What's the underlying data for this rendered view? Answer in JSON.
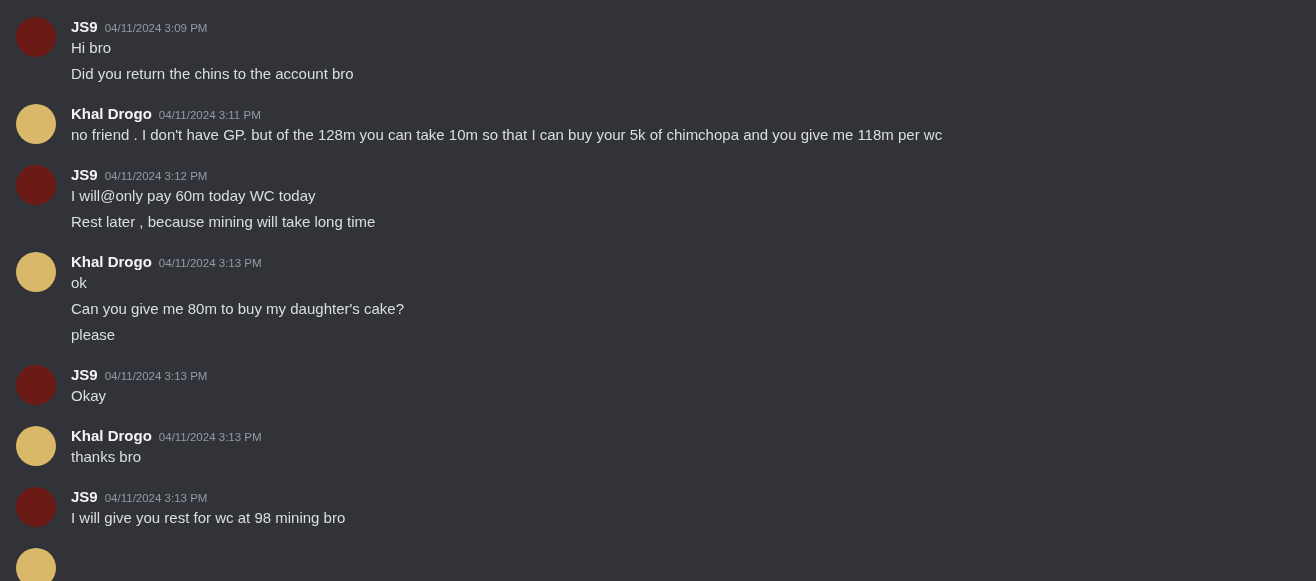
{
  "messages": [
    {
      "author": "JS9",
      "color": "#6b1a16",
      "time": "04/11/2024 3:09 PM",
      "lines": [
        "Hi bro",
        "Did you return the chins to the account bro"
      ]
    },
    {
      "author": "Khal Drogo",
      "color": "#d9b86a",
      "time": "04/11/2024 3:11 PM",
      "lines": [
        "no friend . I don't have GP. but of the 128m you can take 10m so that I can buy your 5k of chimchopa and you give me 118m per wc"
      ]
    },
    {
      "author": "JS9",
      "color": "#6b1a16",
      "time": "04/11/2024 3:12 PM",
      "lines": [
        "I will@only pay 60m today WC today",
        "Rest later , because mining will take long time"
      ]
    },
    {
      "author": "Khal Drogo",
      "color": "#d9b86a",
      "time": "04/11/2024 3:13 PM",
      "lines": [
        "ok",
        "Can you give me 80m to buy my daughter's cake?",
        "please"
      ]
    },
    {
      "author": "JS9",
      "color": "#6b1a16",
      "time": "04/11/2024 3:13 PM",
      "lines": [
        "Okay"
      ]
    },
    {
      "author": "Khal Drogo",
      "color": "#d9b86a",
      "time": "04/11/2024 3:13 PM",
      "lines": [
        "thanks bro"
      ]
    },
    {
      "author": "JS9",
      "color": "#6b1a16",
      "time": "04/11/2024 3:13 PM",
      "lines": [
        "I will give you rest for wc at 98 mining bro"
      ]
    }
  ],
  "cut_off_avatar": {
    "color": "#d9b86a"
  }
}
